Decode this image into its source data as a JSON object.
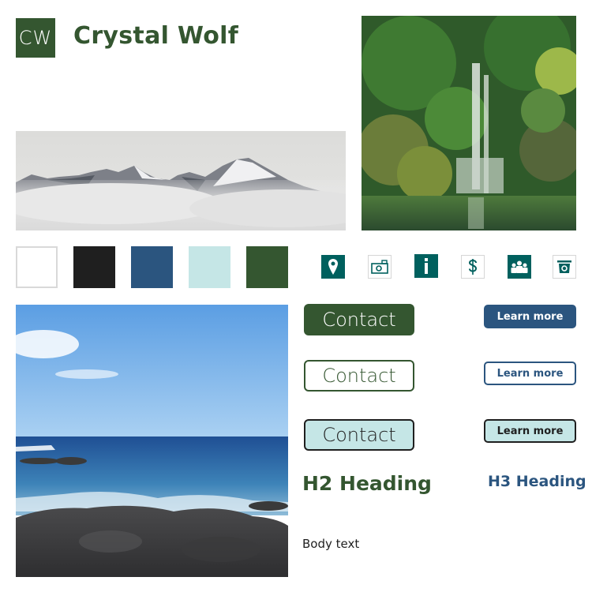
{
  "brand": {
    "logo_initials": "CW",
    "name": "Crystal Wolf"
  },
  "images": {
    "mountain": "mountain-peaks-in-clouds-photo",
    "waterfall": "forest-waterfall-photo",
    "ocean": "ocean-rocky-shore-photo"
  },
  "palette": [
    {
      "name": "white",
      "hex": "#ffffff"
    },
    {
      "name": "black",
      "hex": "#1f1f1f"
    },
    {
      "name": "navy-blue",
      "hex": "#2b557f"
    },
    {
      "name": "light-aqua",
      "hex": "#c5e6e6"
    },
    {
      "name": "forest-green",
      "hex": "#345630"
    }
  ],
  "icons": [
    {
      "name": "map-pin-icon",
      "style": "filled"
    },
    {
      "name": "camera-icon",
      "style": "outline"
    },
    {
      "name": "info-icon",
      "style": "filled"
    },
    {
      "name": "dollar-icon",
      "style": "outline"
    },
    {
      "name": "group-icon",
      "style": "filled"
    },
    {
      "name": "register-icon",
      "style": "outline"
    }
  ],
  "icon_color": "#00605e",
  "buttons": {
    "contact_primary": "Contact",
    "contact_outline": "Contact",
    "contact_alt": "Contact",
    "learn_primary": "Learn more",
    "learn_outline": "Learn more",
    "learn_alt": "Learn more"
  },
  "typography": {
    "h2": "H2 Heading",
    "h3": "H3 Heading",
    "body": "Body text"
  }
}
